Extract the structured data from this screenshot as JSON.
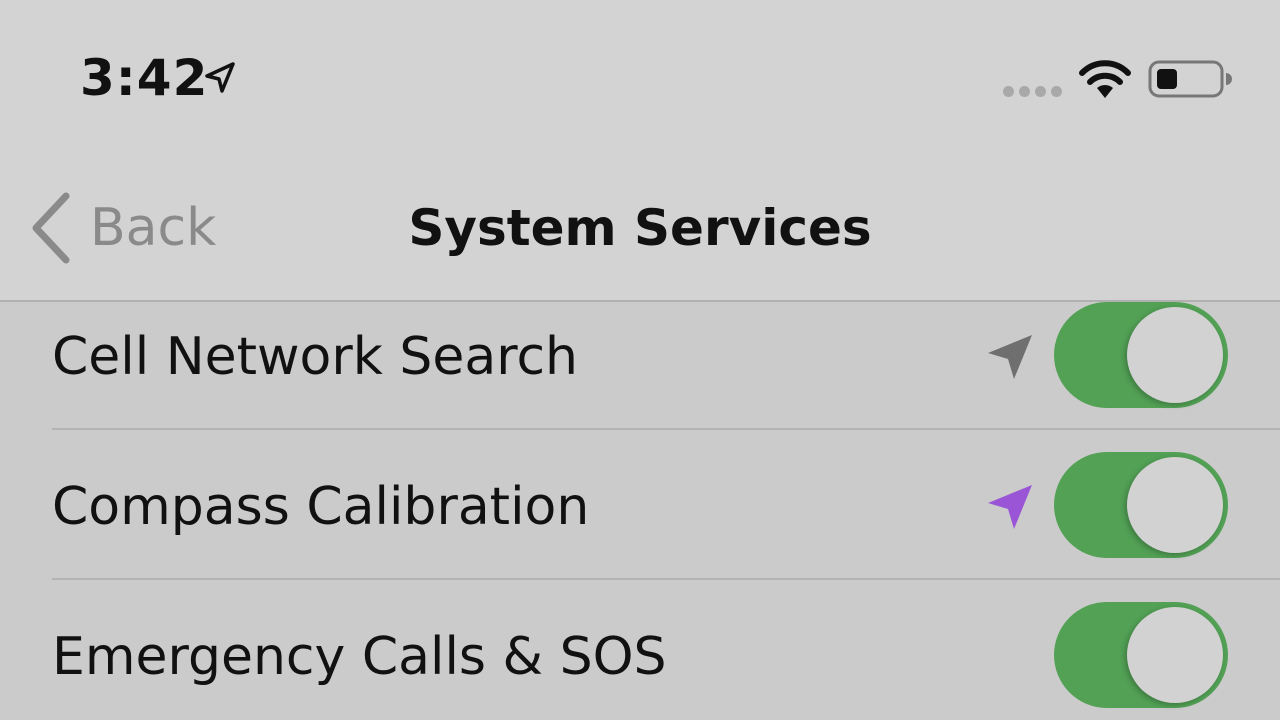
{
  "status_bar": {
    "time": "3:42",
    "location_icon": "location-arrow-icon",
    "wifi_icon": "wifi-icon",
    "battery_icon": "battery-icon"
  },
  "nav": {
    "back_label": "Back",
    "title": "System Services"
  },
  "rows": [
    {
      "label": "Cell Network Search",
      "toggle_on": true,
      "location_indicator": "gray"
    },
    {
      "label": "Compass Calibration",
      "toggle_on": true,
      "location_indicator": "purple"
    },
    {
      "label": "Emergency Calls & SOS",
      "toggle_on": true,
      "location_indicator": "none"
    }
  ],
  "colors": {
    "toggle_on": "#52a155",
    "location_gray": "#6f6f6f",
    "location_purple": "#9a54d6"
  }
}
